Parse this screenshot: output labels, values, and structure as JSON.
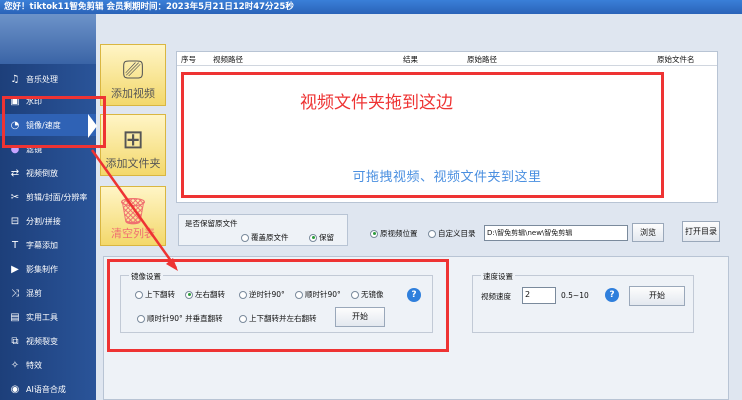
{
  "titlebar": {
    "text": "您好！tiktok11智免剪辑 会员剩期时间：2023年5月21日12时47分25秒"
  },
  "sidebar": {
    "items": [
      {
        "label": "音乐处理",
        "icon": "music-icon"
      },
      {
        "label": "水印",
        "icon": "watermark-icon"
      },
      {
        "label": "镜像/速度",
        "icon": "speed-icon"
      },
      {
        "label": "滤镜",
        "icon": "filter-icon"
      },
      {
        "label": "视频倒放",
        "icon": "reverse-icon"
      },
      {
        "label": "剪辑/封面/分辨率",
        "icon": "scissors-icon"
      },
      {
        "label": "分割/拼接",
        "icon": "split-icon"
      },
      {
        "label": "字幕添加",
        "icon": "subtitle-icon"
      },
      {
        "label": "影集制作",
        "icon": "album-icon"
      },
      {
        "label": "混剪",
        "icon": "shuffle-icon"
      },
      {
        "label": "实用工具",
        "icon": "tools-icon"
      },
      {
        "label": "视频裂变",
        "icon": "fission-icon"
      },
      {
        "label": "特效",
        "icon": "effects-icon"
      },
      {
        "label": "AI语音合成",
        "icon": "ai-voice-icon"
      }
    ]
  },
  "buttons": {
    "add_video": "添加视频",
    "add_folder": "添加文件夹",
    "clear_list": "清空列表"
  },
  "table": {
    "columns": [
      "序号",
      "视频路径",
      "结果",
      "原始路径",
      "原始文件名"
    ],
    "drop_hint": "可拖拽视频、视频文件夹到这里"
  },
  "annotation": {
    "text": "视频文件夹拖到这边"
  },
  "options": {
    "keep_original_label": "是否保留原文件",
    "overwrite_label": "覆盖原文件",
    "keep_label": "保留",
    "original_location_label": "原视频位置",
    "custom_directory_label": "自定义目录",
    "path_value": "D:\\智免剪辑\\new\\智免剪辑",
    "browse_label": "浏览",
    "open_directory_label": "打开目录"
  },
  "mirror": {
    "title": "镜像设置",
    "options": [
      "上下翻转",
      "左右翻转",
      "逆时针90°",
      "顺时针90°",
      "无镜像",
      "顺时针90° 并垂直翻转",
      "上下翻转并左右翻转"
    ],
    "selected": "左右翻转",
    "start_label": "开始",
    "help": "?"
  },
  "speed": {
    "title": "速度设置",
    "label": "视频速度",
    "value": "2",
    "range": "0.5~10",
    "start_label": "开始",
    "help": "?"
  },
  "colors": {
    "accent_red": "#ee3333",
    "sidebar_blue": "#1d3f7a",
    "button_yellow": "#f3d86b"
  }
}
